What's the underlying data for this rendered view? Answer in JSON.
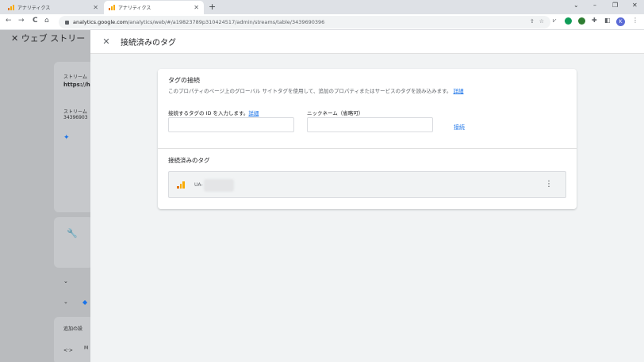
{
  "browser": {
    "tabs": [
      {
        "title": "アナリティクス",
        "close": "✕"
      },
      {
        "title": "アナリティクス",
        "close": "✕"
      }
    ],
    "new_tab": "+",
    "window_controls": [
      "⌄",
      "–",
      "❐",
      "✕"
    ],
    "nav": {
      "back": "←",
      "forward": "→",
      "reload": "C",
      "home": "⌂"
    },
    "address": {
      "host": "analytics.google.com",
      "path": "/analytics/web/#/a19823789p310424517/admin/streams/table/3439690396"
    },
    "profile_initial": "K",
    "extension_colors": [
      "#0f9d58",
      "#2e7d32"
    ]
  },
  "underlay": {
    "header": "✕ ウェブ ストリー",
    "stream_label": "ストリーム",
    "stream_url": "https://h",
    "stream_label2": "ストリーム",
    "stream_id": "34396903",
    "extra_settings": "追加の設",
    "m_label": "M"
  },
  "panel": {
    "close": "✕",
    "title": "接続済みのタグ",
    "connect_section": {
      "title": "タグの接続",
      "description": "このプロパティのページ上のグローバル サイトタグを使用して、追加のプロパティまたはサービスのタグを読み込みます。",
      "details_link": "詳細",
      "tag_id_label": "接続するタグの ID を入力します。",
      "tag_id_link": "詳細",
      "tag_id_value": "",
      "nickname_label": "ニックネーム（省略可）",
      "nickname_value": "",
      "connect_button": "接続"
    },
    "connected_section": {
      "title": "接続済みのタグ",
      "tags": [
        {
          "id_prefix": "UA-",
          "menu": "⋮"
        }
      ]
    }
  },
  "colors": {
    "accent": "#1a73e8",
    "analytics_orange": "#f9ab00",
    "analytics_dark_orange": "#e37400"
  }
}
